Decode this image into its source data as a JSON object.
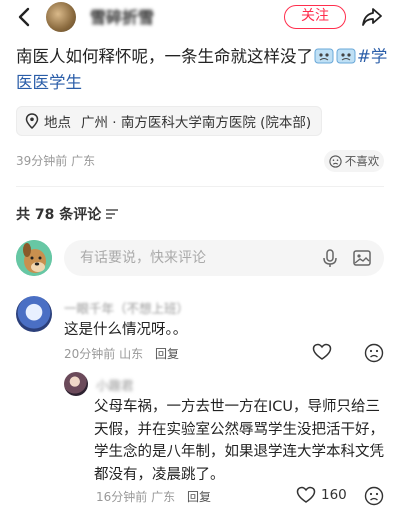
{
  "header": {
    "username": "雪碎折雪",
    "follow_label": "关注"
  },
  "post": {
    "text": "南医人如何释怀呢，一条生命就这样没了",
    "tag_text": "#学医医学生",
    "location_key": "地点",
    "location_value": "广州 · 南方医科大学南方医院 (院本部)",
    "time": "39分钟前",
    "region": "广东",
    "dislike_label": "不喜欢"
  },
  "comments_header": {
    "count_text": "共 78 条评论"
  },
  "input": {
    "placeholder": "有话要说，快来评论"
  },
  "comment1": {
    "name": "一眼千年（不想上班）",
    "text": "这是什么情况呀。。",
    "time": "20分钟前",
    "region": "山东",
    "reply_label": "回复"
  },
  "reply1": {
    "name": "小趣君",
    "text": "父母车祸，一方去世一方在ICU，导师只给三天假，并在实验室公然辱骂学生没把活干好，学生念的是八年制，如果退学连大学本科文凭都没有，凌晨跳了。",
    "time": "16分钟前",
    "region": "广东",
    "reply_label": "回复",
    "likes": "160"
  },
  "colors": {
    "accent": "#ff2e4d",
    "tag": "#2a5da8",
    "muted": "#999999"
  }
}
